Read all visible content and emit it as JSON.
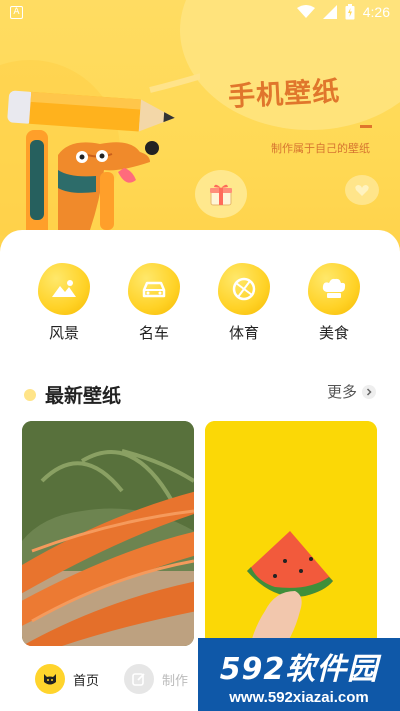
{
  "status_bar": {
    "time": "4:26",
    "app_glyph": "A",
    "icons": [
      "wifi-icon",
      "signal-icon",
      "battery-icon"
    ]
  },
  "hero": {
    "title": "手机壁纸",
    "subtitle": "制作属于自己的壁纸",
    "icons": [
      "gift-icon",
      "heart-icon"
    ]
  },
  "categories": [
    {
      "label": "风景",
      "icon": "landscape-icon"
    },
    {
      "label": "名车",
      "icon": "car-icon"
    },
    {
      "label": "体育",
      "icon": "ball-icon"
    },
    {
      "label": "美食",
      "icon": "chef-hat-icon"
    }
  ],
  "latest": {
    "title": "最新壁纸",
    "more": "更多"
  },
  "wallpapers": [
    {
      "subject": "carrots"
    },
    {
      "subject": "watermelon"
    }
  ],
  "bottom_nav": [
    {
      "label": "首页",
      "icon": "cat-face-icon",
      "active": true
    },
    {
      "label": "制作",
      "icon": "edit-icon",
      "active": false
    }
  ],
  "watermark": {
    "brand": "592软件园",
    "url": "www.592xiazai.com"
  },
  "colors": {
    "hero_bg": "#ffd955",
    "accent": "#ffd226",
    "title": "#e0762c",
    "watermark_bg": "#0f58a8"
  }
}
